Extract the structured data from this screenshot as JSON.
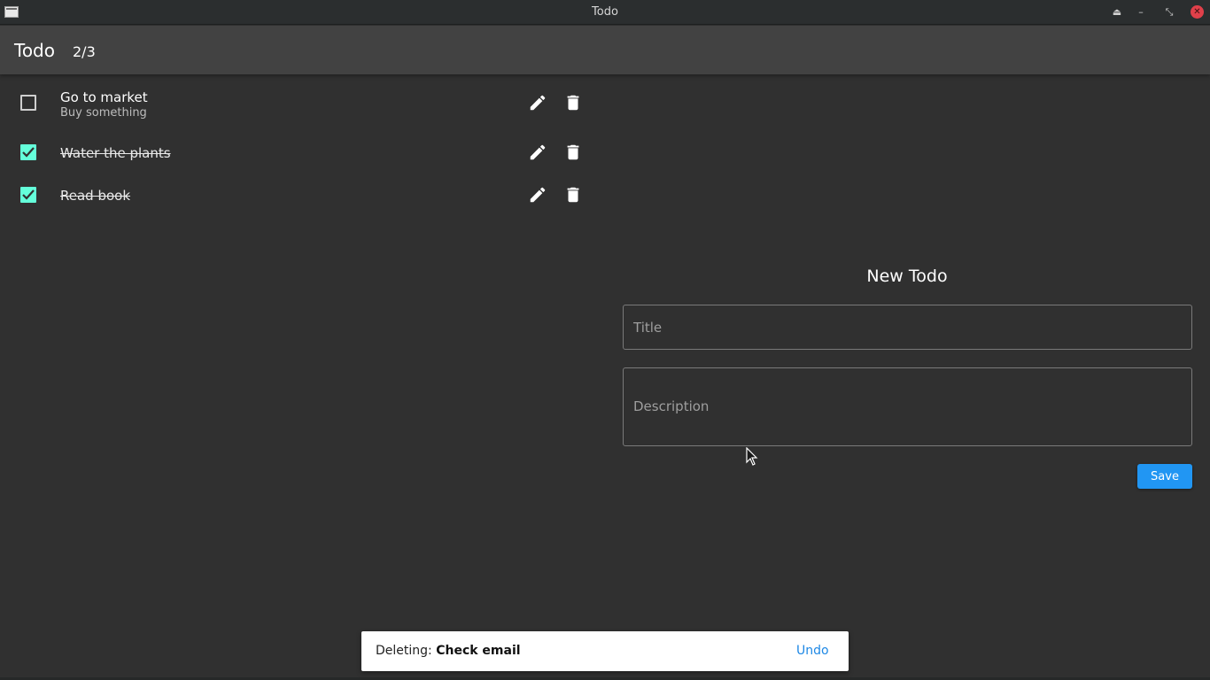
{
  "window": {
    "title": "Todo",
    "buttons": [
      "keep-above-icon",
      "minimize-icon",
      "restore-icon",
      "close-icon"
    ]
  },
  "appbar": {
    "title": "Todo",
    "counter": "2/3"
  },
  "todos": [
    {
      "title": "Go to market",
      "description": "Buy something",
      "done": false
    },
    {
      "title": "Water the plants",
      "description": "",
      "done": true
    },
    {
      "title": "Read book",
      "description": "",
      "done": true
    }
  ],
  "form": {
    "heading": "New Todo",
    "title_placeholder": "Title",
    "description_placeholder": "Description",
    "save_label": "Save"
  },
  "snackbar": {
    "prefix": "Deleting: ",
    "item": "Check email",
    "action": "Undo"
  },
  "colors": {
    "background": "#303030",
    "appbar": "#424242",
    "accent_checkbox": "#64ffda",
    "primary_button": "#2196f3",
    "snackbar_action": "#1e88e5"
  }
}
